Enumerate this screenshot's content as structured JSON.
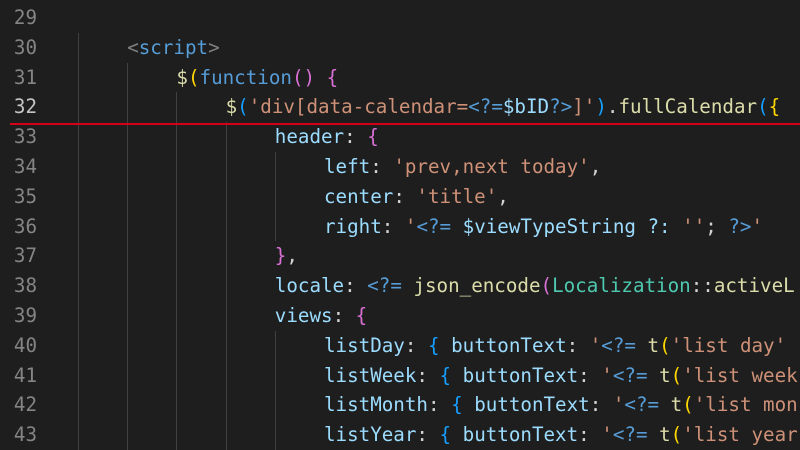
{
  "editor": {
    "lines": [
      {
        "num": "29",
        "indent": 0,
        "tokens": []
      },
      {
        "num": "30",
        "indent": 1,
        "tokens": [
          {
            "t": "<",
            "c": "t-punc"
          },
          {
            "t": "script",
            "c": "t-tag"
          },
          {
            "t": ">",
            "c": "t-punc"
          }
        ]
      },
      {
        "num": "31",
        "indent": 2,
        "tokens": [
          {
            "t": "$",
            "c": "t-func"
          },
          {
            "t": "(",
            "c": "t-br1"
          },
          {
            "t": "function",
            "c": "t-kw"
          },
          {
            "t": "() ",
            "c": "t-br2"
          },
          {
            "t": "{",
            "c": "t-br2"
          }
        ]
      },
      {
        "num": "32",
        "indent": 3,
        "tokens": [
          {
            "t": "$",
            "c": "t-func"
          },
          {
            "t": "(",
            "c": "t-br3"
          },
          {
            "t": "'div[data-calendar=",
            "c": "t-str"
          },
          {
            "t": "<?=",
            "c": "t-php"
          },
          {
            "t": "$bID",
            "c": "t-prop"
          },
          {
            "t": "?>",
            "c": "t-php"
          },
          {
            "t": "]'",
            "c": "t-str"
          },
          {
            "t": ")",
            "c": "t-br3"
          },
          {
            "t": ".",
            "c": "t-plain"
          },
          {
            "t": "fullCalendar",
            "c": "t-func"
          },
          {
            "t": "(",
            "c": "t-br3"
          },
          {
            "t": "{",
            "c": "t-br1"
          }
        ]
      },
      {
        "num": "33",
        "indent": 4,
        "tokens": [
          {
            "t": "header",
            "c": "t-prop"
          },
          {
            "t": ": ",
            "c": "t-plain"
          },
          {
            "t": "{",
            "c": "t-br2"
          }
        ]
      },
      {
        "num": "34",
        "indent": 5,
        "tokens": [
          {
            "t": "left",
            "c": "t-prop"
          },
          {
            "t": ": ",
            "c": "t-plain"
          },
          {
            "t": "'prev,next today'",
            "c": "t-str"
          },
          {
            "t": ",",
            "c": "t-plain"
          }
        ]
      },
      {
        "num": "35",
        "indent": 5,
        "tokens": [
          {
            "t": "center",
            "c": "t-prop"
          },
          {
            "t": ": ",
            "c": "t-plain"
          },
          {
            "t": "'title'",
            "c": "t-str"
          },
          {
            "t": ",",
            "c": "t-plain"
          }
        ]
      },
      {
        "num": "36",
        "indent": 5,
        "tokens": [
          {
            "t": "right",
            "c": "t-prop"
          },
          {
            "t": ": ",
            "c": "t-plain"
          },
          {
            "t": "'",
            "c": "t-str"
          },
          {
            "t": "<?=",
            "c": "t-php"
          },
          {
            "t": " $viewTypeString ?: ",
            "c": "t-prop"
          },
          {
            "t": "''",
            "c": "t-str"
          },
          {
            "t": "; ",
            "c": "t-plain"
          },
          {
            "t": "?>",
            "c": "t-php"
          },
          {
            "t": "'",
            "c": "t-str"
          }
        ]
      },
      {
        "num": "37",
        "indent": 4,
        "tokens": [
          {
            "t": "}",
            "c": "t-br2"
          },
          {
            "t": ",",
            "c": "t-plain"
          }
        ]
      },
      {
        "num": "38",
        "indent": 4,
        "tokens": [
          {
            "t": "locale",
            "c": "t-prop"
          },
          {
            "t": ": ",
            "c": "t-plain"
          },
          {
            "t": "<?=",
            "c": "t-php"
          },
          {
            "t": " ",
            "c": "t-plain"
          },
          {
            "t": "json_encode",
            "c": "t-func"
          },
          {
            "t": "(",
            "c": "t-br2"
          },
          {
            "t": "Localization",
            "c": "t-type"
          },
          {
            "t": "::",
            "c": "t-plain"
          },
          {
            "t": "activeL",
            "c": "t-func"
          }
        ]
      },
      {
        "num": "39",
        "indent": 4,
        "tokens": [
          {
            "t": "views",
            "c": "t-prop"
          },
          {
            "t": ": ",
            "c": "t-plain"
          },
          {
            "t": "{",
            "c": "t-br2"
          }
        ]
      },
      {
        "num": "40",
        "indent": 5,
        "tokens": [
          {
            "t": "listDay",
            "c": "t-prop"
          },
          {
            "t": ": ",
            "c": "t-plain"
          },
          {
            "t": "{",
            "c": "t-br3"
          },
          {
            "t": " buttonText",
            "c": "t-prop"
          },
          {
            "t": ": ",
            "c": "t-plain"
          },
          {
            "t": "'",
            "c": "t-str"
          },
          {
            "t": "<?=",
            "c": "t-php"
          },
          {
            "t": " ",
            "c": "t-plain"
          },
          {
            "t": "t",
            "c": "t-func"
          },
          {
            "t": "(",
            "c": "t-br1"
          },
          {
            "t": "'list day'",
            "c": "t-str"
          }
        ]
      },
      {
        "num": "41",
        "indent": 5,
        "tokens": [
          {
            "t": "listWeek",
            "c": "t-prop"
          },
          {
            "t": ": ",
            "c": "t-plain"
          },
          {
            "t": "{",
            "c": "t-br3"
          },
          {
            "t": " buttonText",
            "c": "t-prop"
          },
          {
            "t": ": ",
            "c": "t-plain"
          },
          {
            "t": "'",
            "c": "t-str"
          },
          {
            "t": "<?=",
            "c": "t-php"
          },
          {
            "t": " ",
            "c": "t-plain"
          },
          {
            "t": "t",
            "c": "t-func"
          },
          {
            "t": "(",
            "c": "t-br1"
          },
          {
            "t": "'list week",
            "c": "t-str"
          }
        ]
      },
      {
        "num": "42",
        "indent": 5,
        "tokens": [
          {
            "t": "listMonth",
            "c": "t-prop"
          },
          {
            "t": ": ",
            "c": "t-plain"
          },
          {
            "t": "{",
            "c": "t-br3"
          },
          {
            "t": " buttonText",
            "c": "t-prop"
          },
          {
            "t": ": ",
            "c": "t-plain"
          },
          {
            "t": "'",
            "c": "t-str"
          },
          {
            "t": "<?=",
            "c": "t-php"
          },
          {
            "t": " ",
            "c": "t-plain"
          },
          {
            "t": "t",
            "c": "t-func"
          },
          {
            "t": "(",
            "c": "t-br1"
          },
          {
            "t": "'list mon",
            "c": "t-str"
          }
        ]
      },
      {
        "num": "43",
        "indent": 5,
        "tokens": [
          {
            "t": "listYear",
            "c": "t-prop"
          },
          {
            "t": ": ",
            "c": "t-plain"
          },
          {
            "t": "{",
            "c": "t-br3"
          },
          {
            "t": " buttonText",
            "c": "t-prop"
          },
          {
            "t": ": ",
            "c": "t-plain"
          },
          {
            "t": "'",
            "c": "t-str"
          },
          {
            "t": "<?=",
            "c": "t-php"
          },
          {
            "t": " ",
            "c": "t-plain"
          },
          {
            "t": "t",
            "c": "t-func"
          },
          {
            "t": "(",
            "c": "t-br1"
          },
          {
            "t": "'list year",
            "c": "t-str"
          }
        ]
      }
    ],
    "active_line": "32",
    "colors": {
      "background": "#1e1e1e",
      "underline": "#d4001a",
      "line_number": "#858585"
    }
  }
}
